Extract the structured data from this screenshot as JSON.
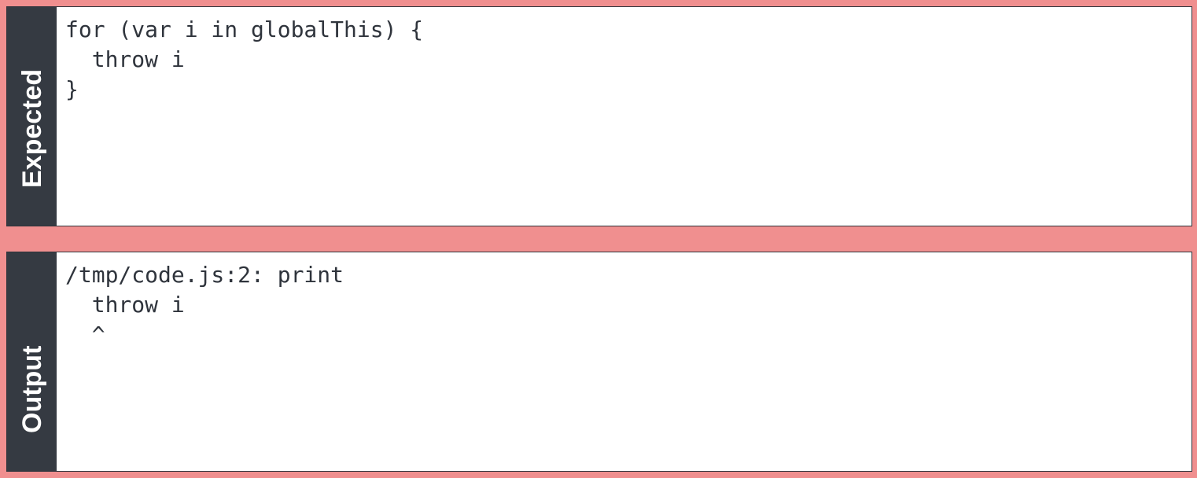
{
  "panels": [
    {
      "label": "Expected",
      "lines": [
        "for (var i in globalThis) {",
        "  throw i",
        "}"
      ]
    },
    {
      "label": "Output",
      "lines": [
        "/tmp/code.js:2: print",
        "  throw i",
        "  ^"
      ]
    }
  ]
}
